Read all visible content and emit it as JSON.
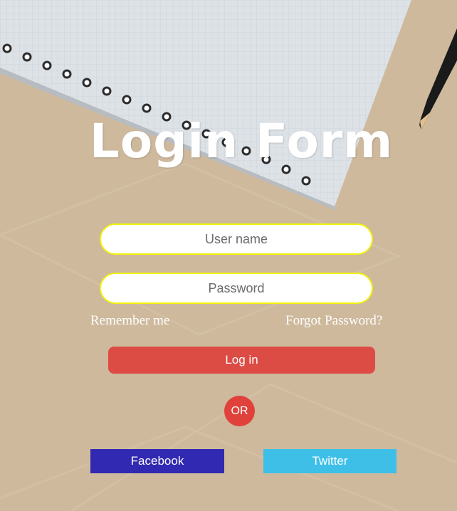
{
  "title": "Login Form",
  "form": {
    "username_placeholder": "User name",
    "username_value": "",
    "password_placeholder": "Password",
    "password_value": "",
    "remember_label": "Remember me",
    "forgot_label": "Forgot Password?",
    "login_label": "Log in",
    "or_label": "OR"
  },
  "social": {
    "facebook_label": "Facebook",
    "twitter_label": "Twitter"
  },
  "colors": {
    "field_border": "#f2f20a",
    "login_button": "#dc4c45",
    "or_circle": "#e0423b",
    "facebook": "#3129b2",
    "twitter": "#3ebfe8"
  }
}
